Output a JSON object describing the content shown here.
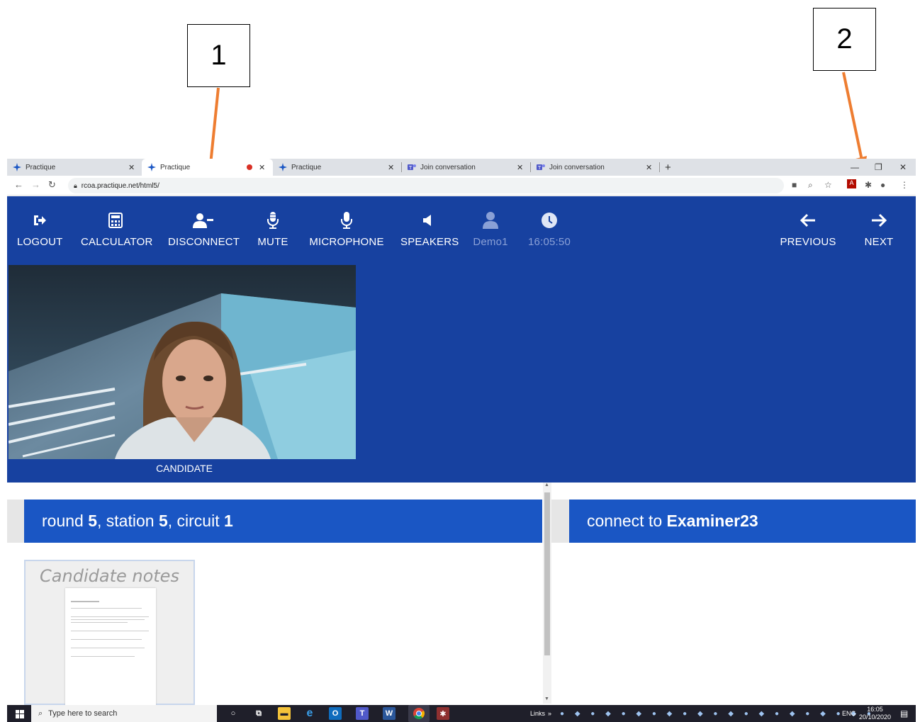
{
  "annotations": [
    {
      "label": "1"
    },
    {
      "label": "2"
    }
  ],
  "browser": {
    "tabs": [
      {
        "title": "Practique",
        "active": false
      },
      {
        "title": "Practique",
        "active": true,
        "recording": true
      },
      {
        "title": "Practique",
        "active": false
      },
      {
        "title": "Join conversation",
        "active": false
      },
      {
        "title": "Join conversation",
        "active": false
      }
    ],
    "new_tab": "+",
    "url": "rcoa.practique.net/html5/"
  },
  "toolbar": {
    "logout": "LOGOUT",
    "calculator": "CALCULATOR",
    "disconnect": "DISCONNECT",
    "mute": "MUTE",
    "microphone": "MICROPHONE",
    "speakers": "SPEAKERS",
    "user": "Demo1",
    "clock": "16:05:50",
    "previous": "PREVIOUS",
    "next": "NEXT"
  },
  "video": {
    "caption": "CANDIDATE"
  },
  "left_header": {
    "round_label": "round ",
    "round": "5",
    "station_label": ", station ",
    "station": "5",
    "circuit_label": ", circuit ",
    "circuit": "1"
  },
  "right_header": {
    "prefix": "connect to ",
    "examiner": "Examiner23"
  },
  "notes": {
    "title": "Candidate notes"
  },
  "taskbar": {
    "search_placeholder": "Type here to search",
    "links": "Links",
    "lang": "ENG",
    "time": "16:05",
    "date": "20/10/2020"
  },
  "colors": {
    "app_blue": "#1741a0",
    "header_blue": "#1a56c4",
    "annotation_arrow": "#ee7d31"
  }
}
